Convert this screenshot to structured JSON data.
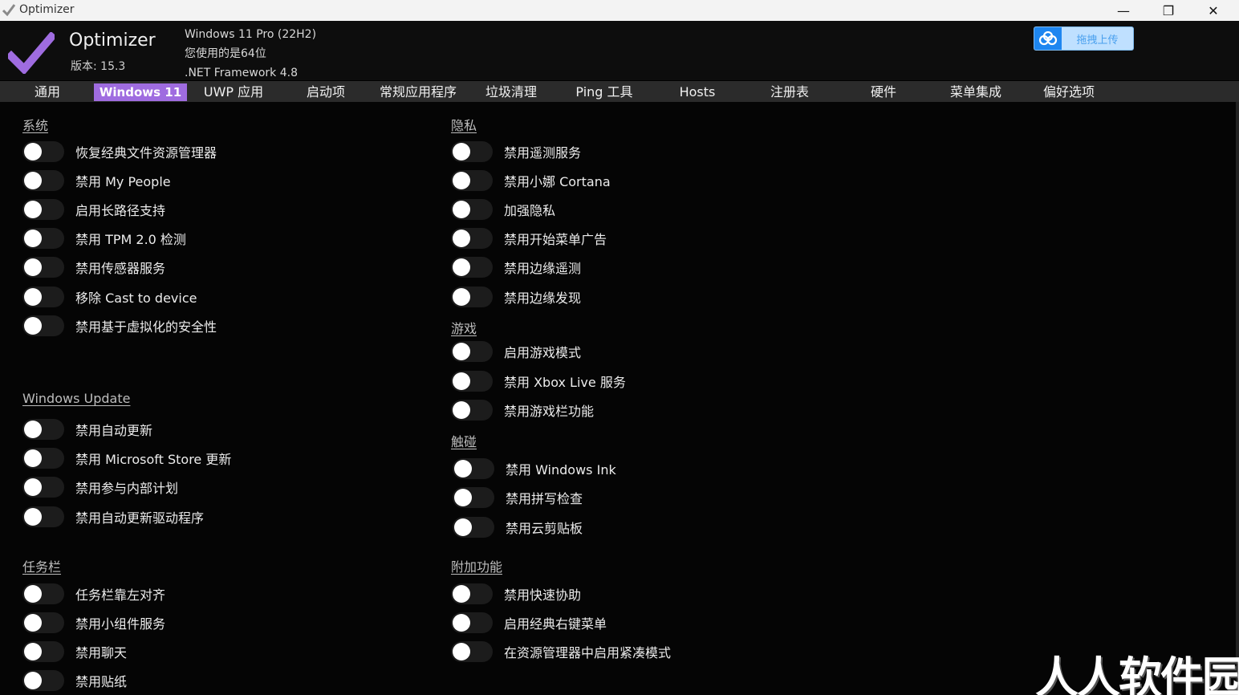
{
  "window": {
    "title": "Optimizer",
    "icon": "check-icon",
    "controls": {
      "minimize": "—",
      "maximize": "❐",
      "close": "✕"
    }
  },
  "header": {
    "app_name": "Optimizer",
    "version": "版本: 15.3",
    "os": "Windows 11 Pro (22H2)",
    "arch": "您使用的是64位",
    "framework": ".NET Framework 4.8",
    "upload_label": "拖拽上传"
  },
  "colors": {
    "accent": "#9f6ce0",
    "upload_blue": "#1e86f0"
  },
  "tabs": [
    {
      "label": "通用",
      "active": false
    },
    {
      "label": "Windows 11",
      "active": true
    },
    {
      "label": "UWP 应用",
      "active": false
    },
    {
      "label": "启动项",
      "active": false
    },
    {
      "label": "常规应用程序",
      "active": false
    },
    {
      "label": "垃圾清理",
      "active": false
    },
    {
      "label": "Ping 工具",
      "active": false
    },
    {
      "label": "Hosts",
      "active": false
    },
    {
      "label": "注册表",
      "active": false
    },
    {
      "label": "硬件",
      "active": false
    },
    {
      "label": "菜单集成",
      "active": false
    },
    {
      "label": "偏好选项",
      "active": false
    }
  ],
  "sections": {
    "system": {
      "title": "系统",
      "items": [
        {
          "label": "恢复经典文件资源管理器",
          "on": false
        },
        {
          "label": "禁用 My People",
          "on": false
        },
        {
          "label": "启用长路径支持",
          "on": false
        },
        {
          "label": "禁用 TPM 2.0 检测",
          "on": false
        },
        {
          "label": "禁用传感器服务",
          "on": false
        },
        {
          "label": "移除 Cast to device",
          "on": false
        },
        {
          "label": "禁用基于虚拟化的安全性",
          "on": false
        }
      ]
    },
    "windows_update": {
      "title": "Windows Update",
      "items": [
        {
          "label": "禁用自动更新",
          "on": false
        },
        {
          "label": "禁用 Microsoft Store 更新",
          "on": false
        },
        {
          "label": "禁用参与内部计划",
          "on": false
        },
        {
          "label": "禁用自动更新驱动程序",
          "on": false
        }
      ]
    },
    "taskbar": {
      "title": "任务栏",
      "items": [
        {
          "label": "任务栏靠左对齐",
          "on": false
        },
        {
          "label": "禁用小组件服务",
          "on": false
        },
        {
          "label": "禁用聊天",
          "on": false
        },
        {
          "label": "禁用贴纸",
          "on": false
        }
      ]
    },
    "privacy": {
      "title": "隐私",
      "items": [
        {
          "label": "禁用遥测服务",
          "on": false
        },
        {
          "label": "禁用小娜 Cortana",
          "on": false
        },
        {
          "label": "加强隐私",
          "on": false
        },
        {
          "label": "禁用开始菜单广告",
          "on": false
        },
        {
          "label": "禁用边缘遥测",
          "on": false
        },
        {
          "label": "禁用边缘发现",
          "on": false
        }
      ]
    },
    "gaming": {
      "title": "游戏",
      "items": [
        {
          "label": "启用游戏模式",
          "on": false
        },
        {
          "label": "禁用 Xbox Live 服务",
          "on": false
        },
        {
          "label": "禁用游戏栏功能",
          "on": false
        }
      ]
    },
    "touch": {
      "title": "触碰",
      "items": [
        {
          "label": "禁用 Windows Ink",
          "on": false
        },
        {
          "label": "禁用拼写检查",
          "on": false
        },
        {
          "label": "禁用云剪贴板",
          "on": false
        }
      ]
    },
    "extras": {
      "title": "附加功能",
      "items": [
        {
          "label": "禁用快速协助",
          "on": false
        },
        {
          "label": "启用经典右键菜单",
          "on": false
        },
        {
          "label": "在资源管理器中启用紧凑模式",
          "on": false
        }
      ]
    }
  },
  "watermark": "人人软件园"
}
